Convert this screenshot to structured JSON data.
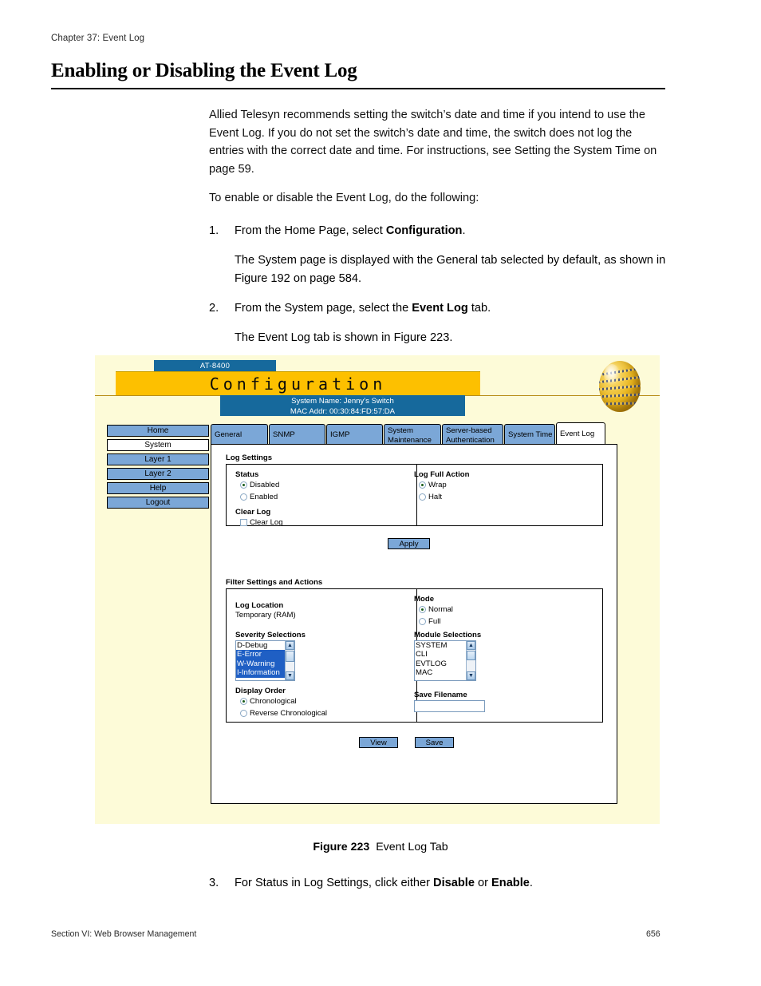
{
  "document": {
    "running_head": "Chapter 37: Event Log",
    "title": "Enabling or Disabling the Event Log",
    "para1": "Allied Telesyn recommends setting the switch’s date and time if you intend to use the Event Log. If you do not set the switch’s date and time, the switch does not log the entries with the correct date and time. For instructions, see Setting the System Time on page 59.",
    "para2": "To enable or disable the Event Log, do the following:",
    "steps": [
      {
        "num": "1.",
        "text_before": "From the Home Page, select ",
        "bold": "Configuration",
        "text_after": "."
      },
      {
        "num": "2.",
        "text_before": "From the System page, select the ",
        "bold": "Event Log",
        "text_after": " tab."
      }
    ],
    "step1_sub": "The System page is displayed with the General tab selected by default, as shown in Figure 192 on page 584.",
    "step2_sub": "The Event Log tab is shown in Figure 223.",
    "step3": {
      "num": "3.",
      "text_before": "For Status in Log Settings, click either ",
      "bold1": "Disable",
      "text_mid": " or ",
      "bold2": "Enable",
      "text_after": "."
    },
    "figure_caption": {
      "label": "Figure 223",
      "text": "Event Log Tab"
    },
    "footer_left": "Section VI: Web Browser Management",
    "footer_right": "656"
  },
  "screenshot": {
    "model_tab": "AT-8400",
    "banner_title": "Configuration",
    "system_name_line": "System Name: Jenny's Switch",
    "mac_addr_line": "MAC Addr: 00:30:84:FD:57:DA",
    "logo_icon": "globe-icon",
    "nav": [
      {
        "label": "Home",
        "active": false
      },
      {
        "label": "System",
        "active": true
      },
      {
        "label": "Layer 1",
        "active": false
      },
      {
        "label": "Layer 2",
        "active": false
      },
      {
        "label": "Help",
        "active": false
      },
      {
        "label": "Logout",
        "active": false
      }
    ],
    "tabs": [
      {
        "label": "General",
        "active": false
      },
      {
        "label": "SNMP",
        "active": false
      },
      {
        "label": "IGMP",
        "active": false
      },
      {
        "label": "System\nMaintenance",
        "active": false
      },
      {
        "label": "Server-based\nAuthentication",
        "active": false
      },
      {
        "label": "System Time",
        "active": false
      },
      {
        "label": "Event Log",
        "active": true
      }
    ],
    "log_settings": {
      "group_label": "Log Settings",
      "status_label": "Status",
      "status_options": [
        {
          "label": "Disabled",
          "selected": true
        },
        {
          "label": "Enabled",
          "selected": false
        }
      ],
      "clear_log_label": "Clear Log",
      "clear_log_checkbox_label": "Clear Log",
      "clear_log_checked": false,
      "log_full_action_label": "Log Full Action",
      "log_full_action_options": [
        {
          "label": "Wrap",
          "selected": true
        },
        {
          "label": "Halt",
          "selected": false
        }
      ],
      "apply_button": "Apply"
    },
    "filter_settings": {
      "group_label": "Filter Settings and Actions",
      "log_location_label": "Log Location",
      "log_location_value": "Temporary (RAM)",
      "severity_label": "Severity Selections",
      "severity_items": [
        {
          "label": "D-Debug",
          "selected": false
        },
        {
          "label": "E-Error",
          "selected": true
        },
        {
          "label": "W-Warning",
          "selected": true
        },
        {
          "label": "I-Information",
          "selected": true
        }
      ],
      "display_order_label": "Display Order",
      "display_order_options": [
        {
          "label": "Chronological",
          "selected": true
        },
        {
          "label": "Reverse Chronological",
          "selected": false
        }
      ],
      "mode_label": "Mode",
      "mode_options": [
        {
          "label": "Normal",
          "selected": true
        },
        {
          "label": "Full",
          "selected": false
        }
      ],
      "module_label": "Module Selections",
      "module_items": [
        {
          "label": "SYSTEM",
          "selected": false
        },
        {
          "label": "CLI",
          "selected": false
        },
        {
          "label": "EVTLOG",
          "selected": false
        },
        {
          "label": "MAC",
          "selected": false
        }
      ],
      "save_filename_label": "Save Filename",
      "save_filename_value": "",
      "view_button": "View",
      "save_button": "Save"
    },
    "colors": {
      "page_bg": "#fdfbd8",
      "banner_gold": "#fdc000",
      "header_blue": "#16699c",
      "button_blue": "#7ba7d7",
      "selection_blue": "#1f5fc4"
    }
  }
}
